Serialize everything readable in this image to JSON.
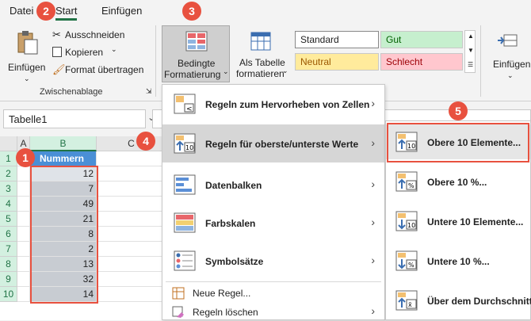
{
  "tabs": {
    "file": "Datei",
    "start": "Start",
    "insert": "Einfügen"
  },
  "clipboard": {
    "paste": "Einfügen",
    "cut": "Ausschneiden",
    "copy": "Kopieren",
    "format_painter": "Format übertragen",
    "group_label": "Zwischenablage"
  },
  "conditional": {
    "line1": "Bedingte",
    "line2": "Formatierung"
  },
  "as_table": {
    "line1": "Als Tabelle",
    "line2": "formatieren"
  },
  "styles": {
    "standard": "Standard",
    "gut": "Gut",
    "neutral": "Neutral",
    "schlecht": "Schlecht"
  },
  "insert_right": {
    "label": "Einfügen"
  },
  "namebox": {
    "value": "Tabelle1"
  },
  "columns": [
    "A",
    "B",
    "C"
  ],
  "rows": [
    "1",
    "2",
    "3",
    "4",
    "5",
    "6",
    "7",
    "8",
    "9",
    "10"
  ],
  "header_cell": "Nummern",
  "values": [
    "12",
    "7",
    "49",
    "21",
    "8",
    "2",
    "13",
    "32",
    "14"
  ],
  "menu": {
    "items": [
      {
        "label": "Regeln zum Hervorheben von Zellen"
      },
      {
        "label": "Regeln für oberste/unterste Werte"
      },
      {
        "label": "Datenbalken"
      },
      {
        "label": "Farbskalen"
      },
      {
        "label": "Symbolsätze"
      }
    ],
    "new_rule": "Neue Regel...",
    "clear_rules": "Regeln löschen"
  },
  "submenu": {
    "items": [
      {
        "label": "Obere 10 Elemente..."
      },
      {
        "label": "Obere 10 %..."
      },
      {
        "label": "Untere 10 Elemente..."
      },
      {
        "label": "Untere 10 %..."
      },
      {
        "label": "Über dem Durchschnitt"
      }
    ]
  },
  "badges": [
    "1",
    "2",
    "3",
    "4",
    "5"
  ],
  "colors": {
    "accent": "#217346",
    "badge": "#e8513f",
    "selection": "#c8ccd2"
  }
}
